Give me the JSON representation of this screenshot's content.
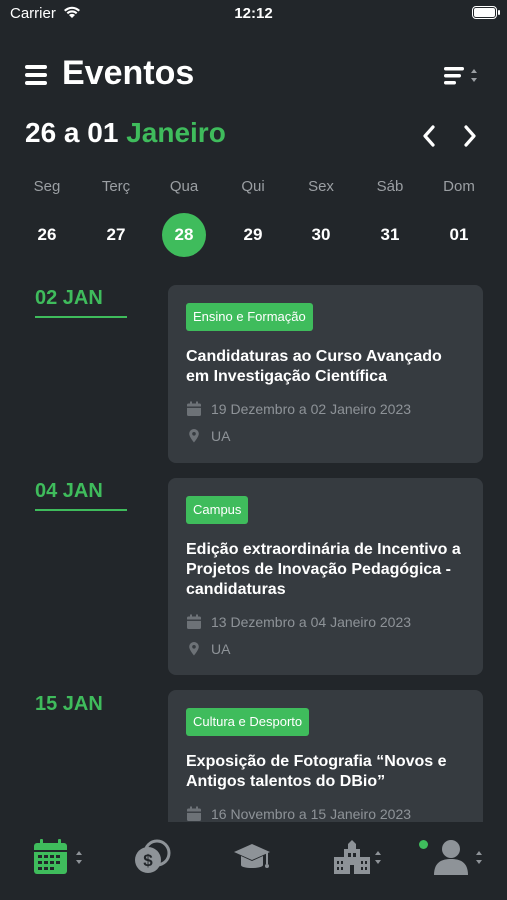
{
  "status_bar": {
    "carrier": "Carrier",
    "time": "12:12"
  },
  "header": {
    "title": "Eventos"
  },
  "range": {
    "prefix": "26 a 01 ",
    "month": "Janeiro"
  },
  "weekdays": [
    "Seg",
    "Terç",
    "Qua",
    "Qui",
    "Sex",
    "Sáb",
    "Dom"
  ],
  "days": [
    "26",
    "27",
    "28",
    "29",
    "30",
    "31",
    "01"
  ],
  "selected_day": "28",
  "colors": {
    "accent": "#3fbc5c",
    "background": "#22262a",
    "card": "#363b40"
  },
  "events": [
    {
      "date": "02 JAN",
      "category": "Ensino e Formação",
      "title": "Candidaturas ao Curso Avançado em Investigação Científica",
      "period": "19 Dezembro a 02 Janeiro 2023",
      "location": "UA"
    },
    {
      "date": "04 JAN",
      "category": "Campus",
      "title": "Edição extraordinária de Incentivo a Projetos de Inovação Pedagógica - candidaturas",
      "period": "13 Dezembro a 04 Janeiro 2023",
      "location": "UA"
    },
    {
      "date": "15 JAN",
      "category": "Cultura e Desporto",
      "title": "Exposição de Fotografia “Novos e Antigos talentos do DBio”",
      "period": "16 Novembro a 15 Janeiro 2023",
      "location": ""
    }
  ],
  "tabbar": {
    "items": [
      {
        "icon": "calendar-icon",
        "active": true
      },
      {
        "icon": "coins-icon",
        "active": false
      },
      {
        "icon": "graduation-cap-icon",
        "active": false
      },
      {
        "icon": "building-icon",
        "active": false
      },
      {
        "icon": "user-icon",
        "active": false,
        "notification": true
      }
    ]
  }
}
